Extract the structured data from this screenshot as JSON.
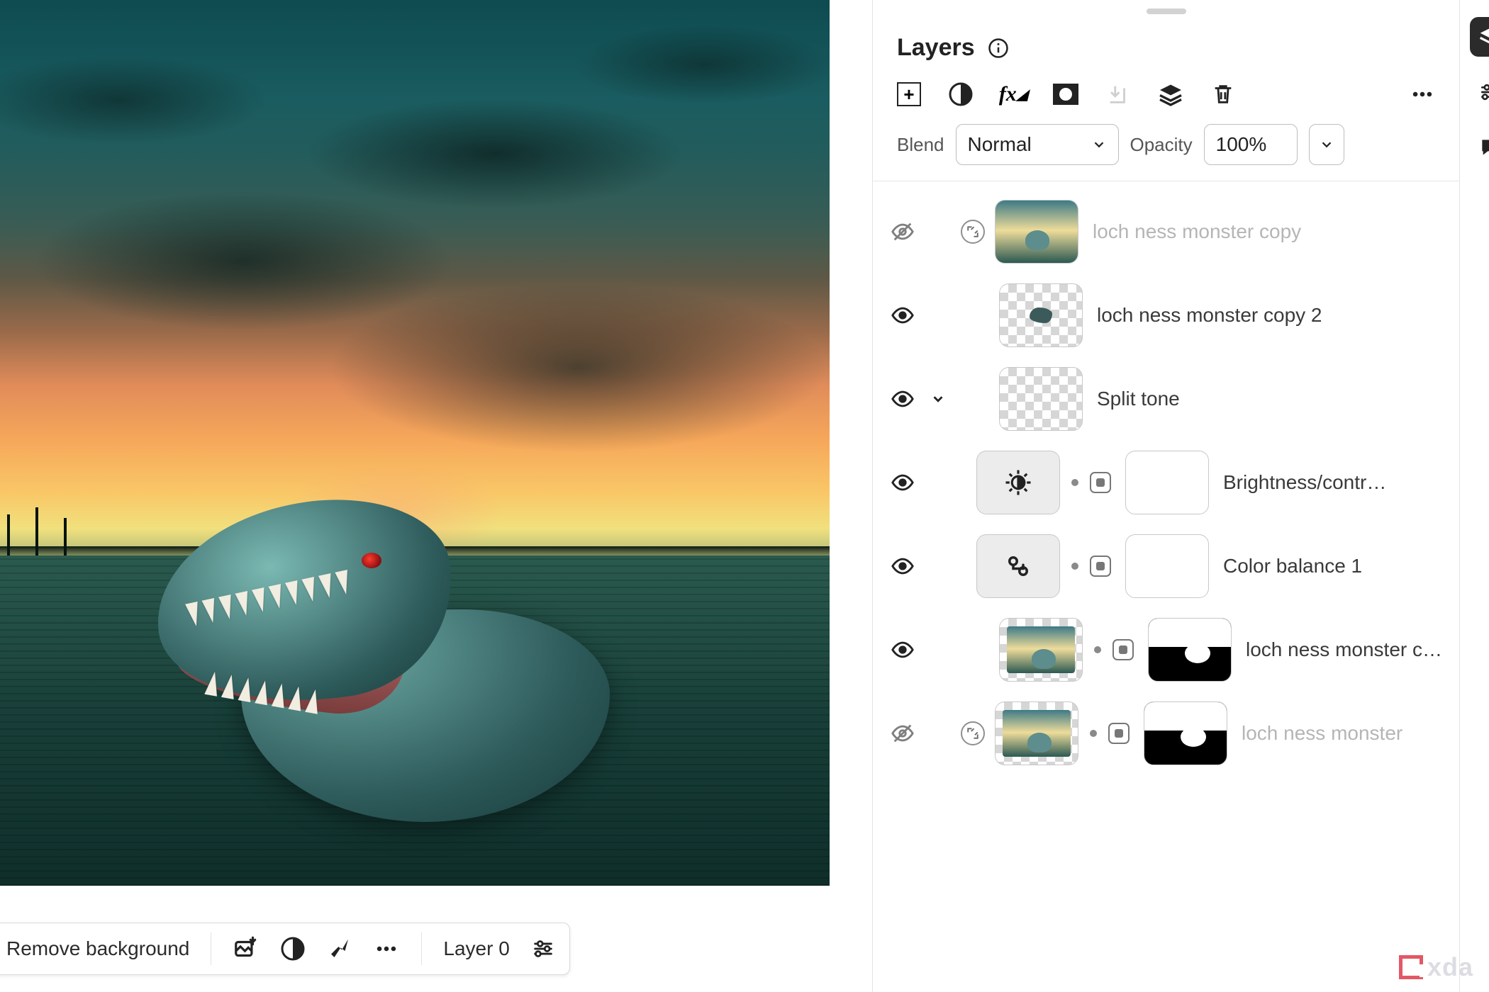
{
  "panel": {
    "title": "Layers"
  },
  "blend": {
    "label": "Blend",
    "mode": "Normal",
    "opacity_label": "Opacity",
    "opacity_value": "100%"
  },
  "bottom": {
    "remove_bg": "Remove background",
    "layer_label": "Layer 0"
  },
  "layers": [
    {
      "name": "loch ness monster copy"
    },
    {
      "name": "loch ness monster copy 2"
    },
    {
      "name": "Split tone"
    },
    {
      "name": "Brightness/contr…"
    },
    {
      "name": "Color balance 1"
    },
    {
      "name": "loch ness monster c…"
    },
    {
      "name": "loch ness monster"
    }
  ],
  "watermark": "xda"
}
